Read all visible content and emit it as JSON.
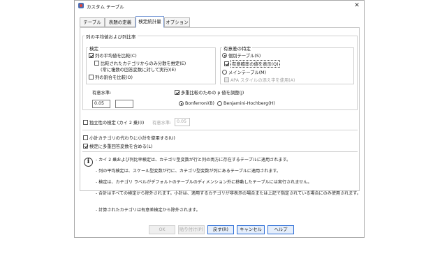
{
  "window": {
    "title": "カスタム テーブル",
    "close_glyph": "✕"
  },
  "tabs": [
    {
      "label": "テーブル"
    },
    {
      "label": "表題の定義"
    },
    {
      "label": "検定統計量"
    },
    {
      "label": "オプション"
    }
  ],
  "column_means_group": {
    "title": "列の平均値および列比率",
    "test_group": {
      "title": "検定",
      "compare_means": {
        "label": "列の平均値を比較(C)",
        "checked": true
      },
      "compare_within": {
        "label": "比較されたカテゴリからのみ分散を推定(E)",
        "checked": false
      },
      "compare_within_note": "(常に複数の回答変数に対して実行)(E)",
      "compare_proportions": {
        "label": "列の割合を比較(O)",
        "checked": false
      }
    },
    "significance_group": {
      "title": "有意差の特定",
      "separate_tables": {
        "label": "個別テーブル(S)",
        "selected": true
      },
      "show_pvalue": {
        "label": "有意確率の値を表示(Q)",
        "checked": true
      },
      "main_table": {
        "label": "メインテーブル(M)",
        "selected": false
      },
      "apa_style": {
        "label": "APA スタイルの添え字を使用(A)",
        "checked": false
      }
    },
    "significance_level": {
      "label": "有意水準:",
      "value1": "0.05",
      "value2": ""
    },
    "adjust_pvalues": {
      "label": "多重比較のための p 値を調整(J)",
      "checked": true
    },
    "bonferroni": {
      "label": "Bonferroni(B)",
      "selected": true
    },
    "benjamini": {
      "label": "Benjamini-Hochberg(H)",
      "selected": false
    }
  },
  "independence": {
    "label": "独立性の検定 (カイ 2 乗)(I)",
    "checked": false,
    "sig_label": "有意水準:",
    "sig_value": "0.05"
  },
  "options": {
    "use_subtotals": {
      "label": "小計カテゴリの代わりに小計を使用する(U)",
      "checked": false
    },
    "include_multiple": {
      "label": "検定に多重回答変数を含める(L)",
      "checked": true
    }
  },
  "info": {
    "icon": "info-icon",
    "notes": [
      "- カイ 2 乗および列比率検定は、カテゴリ型変数が行と列の両方に存在するテーブルに適用されます。",
      "- 列の平均検定は、スケール型変数が行に、カテゴリ型変数が列にあるテーブルに適用されます。",
      "- 検定は、カテゴリ ラベルがデフォルトのテーブルのディメンション外に移動したテーブルには実行されません。",
      "- 合計はすべての検定から除外されます。小計は、適用するカテゴリが非表示の場合または上記で指定されている場合にのみ使用されます。",
      "- 計算されたカテゴリは有意差検定から除外されます。"
    ]
  },
  "buttons": {
    "ok": "OK",
    "paste": "貼り付け(P)",
    "reset": "戻す(R)",
    "cancel": "キャンセル",
    "help": "ヘルプ"
  },
  "colors": {
    "accent": "#2f6fd6",
    "tab_active_border": "#7a9bd6"
  }
}
